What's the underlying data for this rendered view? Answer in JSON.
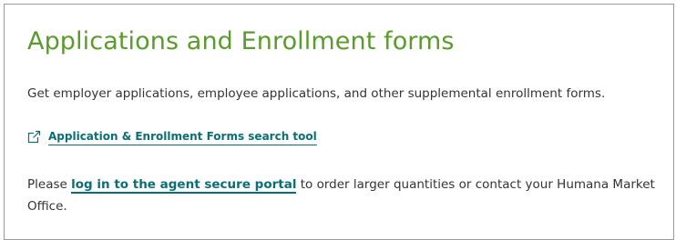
{
  "section": {
    "title": "Applications and Enrollment forms",
    "description": "Get employer applications, employee applications, and other supplemental enrollment forms.",
    "search_tool_link": {
      "label": "Application & Enrollment Forms search tool",
      "icon": "external-link-icon"
    },
    "portal_paragraph": {
      "before": "Please ",
      "link_text": "log in to the agent secure portal",
      "after": " to order larger quantities or contact your Humana Market Office."
    }
  },
  "colors": {
    "title": "#5b9a2c",
    "link": "#0a6e74",
    "body_text": "#333333",
    "border": "#9a9a9a"
  }
}
